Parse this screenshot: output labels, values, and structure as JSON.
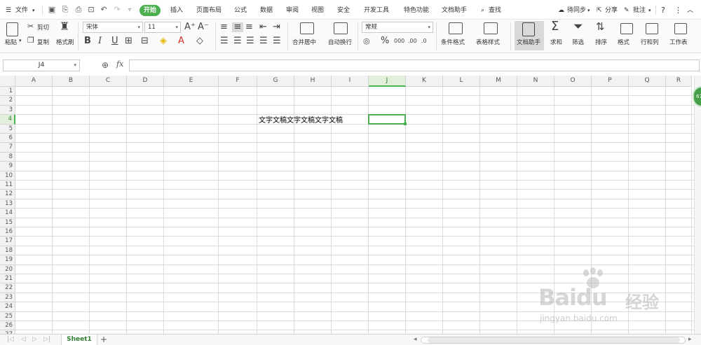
{
  "menubar": {
    "file": "文件",
    "tabs": [
      "开始",
      "插入",
      "页面布局",
      "公式",
      "数据",
      "审阅",
      "视图",
      "安全",
      "开发工具",
      "特色功能",
      "文档助手"
    ],
    "search": "查找",
    "sync": "待同步",
    "share": "分享",
    "annotate": "批注",
    "help": "?"
  },
  "ribbon": {
    "paste": "粘贴",
    "cut": "剪切",
    "copy": "复制",
    "format_painter": "格式刷",
    "font_name": "宋体",
    "font_size": "11",
    "merge_center": "合并居中",
    "wrap_text": "自动换行",
    "number_format": "常规",
    "conditional_format": "条件格式",
    "table_style": "表格样式",
    "doc_helper": "文档助手",
    "sum": "求和",
    "filter": "筛选",
    "sort": "排序",
    "format": "格式",
    "row_col": "行和列",
    "worksheet": "工作表"
  },
  "formula_bar": {
    "cell_ref": "J4",
    "fx": "fx"
  },
  "grid": {
    "columns": [
      "A",
      "B",
      "C",
      "D",
      "E",
      "F",
      "G",
      "H",
      "I",
      "J",
      "K",
      "L",
      "M",
      "N",
      "O",
      "P",
      "Q",
      "R"
    ],
    "rows": [
      "1",
      "2",
      "3",
      "4",
      "5",
      "6",
      "7",
      "8",
      "9",
      "10",
      "11",
      "12",
      "13",
      "14",
      "15",
      "16",
      "17",
      "18",
      "19",
      "20",
      "21",
      "22",
      "23",
      "24",
      "25",
      "26",
      "27"
    ],
    "active_cell": "J4",
    "cells": {
      "G4": "文字文稿文字文稿文字文稿"
    }
  },
  "sheets": {
    "active": "Sheet1",
    "add": "+"
  },
  "float_ball": "67",
  "watermark": {
    "brand": "Bai",
    "brand_du": "du",
    "brand_cn": "经验",
    "url": "jingyan.baidu.com"
  }
}
